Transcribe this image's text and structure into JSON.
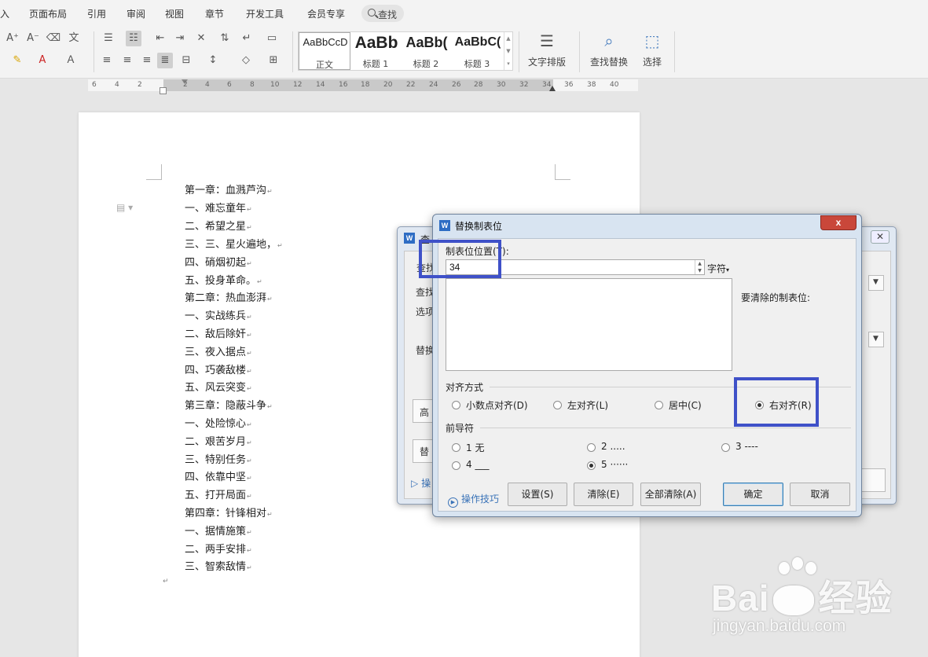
{
  "menu": {
    "items": [
      "入",
      "页面布局",
      "引用",
      "审阅",
      "视图",
      "章节",
      "开发工具",
      "会员专享"
    ],
    "search_label": "查找"
  },
  "ribbon": {
    "styles": [
      {
        "sample": "AaBbCcD",
        "label": "正文"
      },
      {
        "sample": "AaBb",
        "label": "标题 1"
      },
      {
        "sample": "AaBb(",
        "label": "标题 2"
      },
      {
        "sample": "AaBbC(",
        "label": "标题 3"
      }
    ],
    "text_layout_label": "文字排版",
    "find_replace_label": "查找替换",
    "select_label": "选择"
  },
  "ruler": {
    "numbers": [
      "6",
      "4",
      "2",
      "2",
      "4",
      "6",
      "8",
      "10",
      "12",
      "14",
      "16",
      "18",
      "20",
      "22",
      "24",
      "26",
      "28",
      "30",
      "32",
      "34",
      "36",
      "38",
      "40"
    ]
  },
  "document": {
    "lines": [
      "第一章：血溅芦沟",
      "一、难忘童年",
      "二、希望之星",
      "三、三、星火遍地，",
      "四、硝烟初起",
      "五、投身革命。",
      "第二章：热血澎湃",
      "一、实战练兵",
      "二、敌后除奸",
      "三、夜入据点",
      "四、巧袭敌楼",
      "五、风云突变",
      "第三章：隐蔽斗争",
      "一、处险惊心",
      "二、艰苦岁月",
      "三、特别任务",
      "四、依靠中坚",
      "五、打开局面",
      "第四章：针锋相对",
      "一、据情施策",
      "二、两手安排",
      "三、智索敌情"
    ],
    "paragraph_mark": "↵"
  },
  "background_dialog": {
    "title": "查",
    "tab_label": "查找",
    "find_label": "查找",
    "options_label": "选项",
    "replace_label": "替换",
    "advanced_label": "高",
    "replace_btn_label": "替",
    "tips_label": "操"
  },
  "dialog": {
    "title": "替换制表位",
    "close_label": "x",
    "position_label": "制表位位置(T):",
    "position_value": "34",
    "unit_label": "字符",
    "clear_label": "要清除的制表位:",
    "alignment": {
      "group_label": "对齐方式",
      "options": [
        {
          "label": "小数点对齐(D)",
          "checked": false
        },
        {
          "label": "左对齐(L)",
          "checked": false
        },
        {
          "label": "居中(C)",
          "checked": false
        },
        {
          "label": "右对齐(R)",
          "checked": true
        }
      ]
    },
    "leader": {
      "group_label": "前导符",
      "options": [
        {
          "label": "1 无",
          "checked": false
        },
        {
          "label": "2 .....",
          "checked": false
        },
        {
          "label": "3 ----",
          "checked": false
        },
        {
          "label": "4 ___",
          "checked": false
        },
        {
          "label": "5 ······",
          "checked": true
        }
      ]
    },
    "tips_label": "操作技巧",
    "buttons": {
      "set": "设置(S)",
      "clear": "清除(E)",
      "clear_all": "全部清除(A)",
      "ok": "确定",
      "cancel": "取消"
    }
  },
  "watermark": {
    "brand_prefix": "Bai",
    "brand_suffix": "经验",
    "url": "jingyan.baidu.com"
  },
  "colors": {
    "highlight": "#3f51c8",
    "close_button": "#c9473a",
    "link": "#3a73b8"
  }
}
